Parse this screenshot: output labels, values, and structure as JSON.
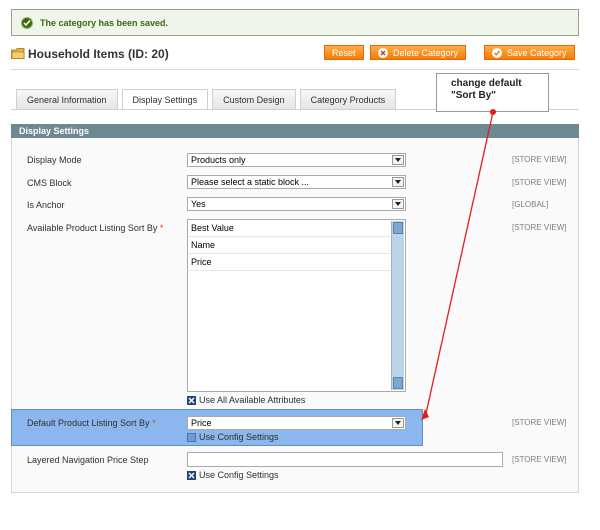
{
  "message": {
    "text": "The category has been saved."
  },
  "header": {
    "title": "Household Items (ID: 20)",
    "buttons": {
      "reset": "Reset",
      "delete": "Delete Category",
      "save": "Save Category"
    }
  },
  "tabs": [
    "General Information",
    "Display Settings",
    "Custom Design",
    "Category Products"
  ],
  "active_tab": "Display Settings",
  "annotation": {
    "line1": "change default",
    "line2": "\"Sort By\""
  },
  "section": {
    "title": "Display Settings"
  },
  "fields": {
    "display_mode": {
      "label": "Display Mode",
      "value": "Products only",
      "scope": "[STORE VIEW]"
    },
    "cms_block": {
      "label": "CMS Block",
      "value": "Please select a static block ...",
      "scope": "[STORE VIEW]"
    },
    "is_anchor": {
      "label": "Is Anchor",
      "value": "Yes",
      "scope": "[GLOBAL]"
    },
    "available_sort": {
      "label": "Available Product Listing Sort By",
      "required_mark": "*",
      "options": [
        "Best Value",
        "Name",
        "Price"
      ],
      "checkbox_label": "Use All Available Attributes",
      "scope": "[STORE VIEW]"
    },
    "default_sort": {
      "label": "Default Product Listing Sort By",
      "required_mark": "*",
      "value": "Price",
      "checkbox_label": "Use Config Settings",
      "scope": "[STORE VIEW]"
    },
    "price_step": {
      "label": "Layered Navigation Price Step",
      "value": "",
      "checkbox_label": "Use Config Settings",
      "scope": "[STORE VIEW]"
    }
  },
  "colors": {
    "accent": "#f17e08",
    "section_bar": "#6f8992",
    "highlight": "#8cb6ee",
    "annotation_arrow": "#e31c1c"
  }
}
